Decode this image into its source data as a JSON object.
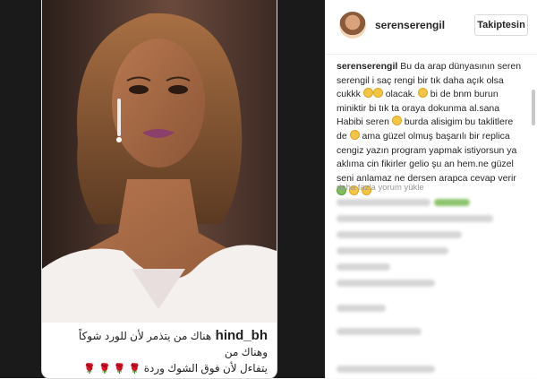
{
  "post": {
    "caption_user": "hind_bh",
    "caption_line1": "هناك من يتذمر لأن للورد شوكاً وهناك من",
    "caption_line2": "يتفاءل لأن فوق الشوك وردة",
    "caption_flowers": "🌹 🌹 🌹 🌹"
  },
  "panel": {
    "username": "serenserengil",
    "follow_label": "Takiptesin",
    "comment_user": "serenserengil",
    "comment_text": "Bu da arap dünyasının seren serengil i saç rengi bir tık daha açık olsa cukkk",
    "comment_text2": " olacak. ",
    "comment_text3": " bi de bnm burun miniktir bi tık ta oraya dokunma al.sana Habibi seren",
    "comment_text4": " burda alisigim bu taklitlere de ",
    "comment_text5": " ama güzel olmuş başarılı bir replica cengiz yazın program yapmak istiyorsun ya aklıma cin fikirler gelio şu an hem.ne güzel seni anlamaz ne dersen arapca cevap verir ",
    "more_comments": "daha fazla yorum yükle"
  },
  "colors": {
    "accent_green": "#7fbf5b",
    "rose": "#e46a8b"
  }
}
